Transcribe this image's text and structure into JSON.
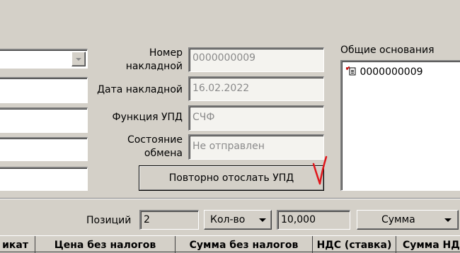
{
  "invoice": {
    "number_label": "Номер накладной",
    "number_label_l1": "Номер",
    "number_label_l2": "накладной",
    "number_value": "0000000009",
    "date_label": "Дата накладной",
    "date_value": "16.02.2022",
    "function_label": "Функция УПД",
    "function_value": "СЧФ",
    "state_label_l1": "Состояние",
    "state_label_l2": "обмена",
    "state_value": "Не отправлен",
    "resend_button": "Повторно отослать УПД"
  },
  "bases": {
    "title": "Общие основания",
    "items": [
      "0000000009"
    ]
  },
  "totals": {
    "positions_label": "Позиций",
    "positions_value": "2",
    "qty_dropdown": "Кол-во",
    "qty_value": "10,000",
    "sum_dropdown": "Сумма"
  },
  "table": {
    "headers": [
      "икат",
      "Цена без налогов",
      "Сумма без налогов",
      "НДС (ставка)",
      "Сумма НДС"
    ]
  },
  "icons": {
    "dropdown": "chevron-down-icon",
    "document": "document-icon",
    "checkmark": "red-checkmark-annotation"
  }
}
